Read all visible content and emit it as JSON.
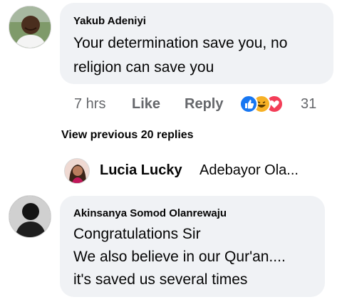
{
  "comment1": {
    "author": "Yakub Adeniyi",
    "line1": "Your determination save you, no",
    "line2": "religion can save you",
    "time": "7 hrs",
    "like_label": "Like",
    "reply_label": "Reply",
    "reaction_icons": [
      "like-icon",
      "haha-icon",
      "love-icon"
    ],
    "reaction_count": "31"
  },
  "replies": {
    "view_previous_label": "View previous 20 replies",
    "preview_author": "Lucia Lucky",
    "preview_snippet": "Adebayor Ola..."
  },
  "comment2": {
    "author": "Akinsanya Somod Olanrewaju",
    "line1": "Congratulations Sir",
    "line2": "We also believe in our Qur'an....",
    "line3": "it's saved us several times"
  },
  "colors": {
    "bubble": "#f0f2f5",
    "secondary_text": "#65676b",
    "like_blue": "#1877f2",
    "haha_yellow": "#f7b125",
    "love_red": "#f33e58"
  }
}
